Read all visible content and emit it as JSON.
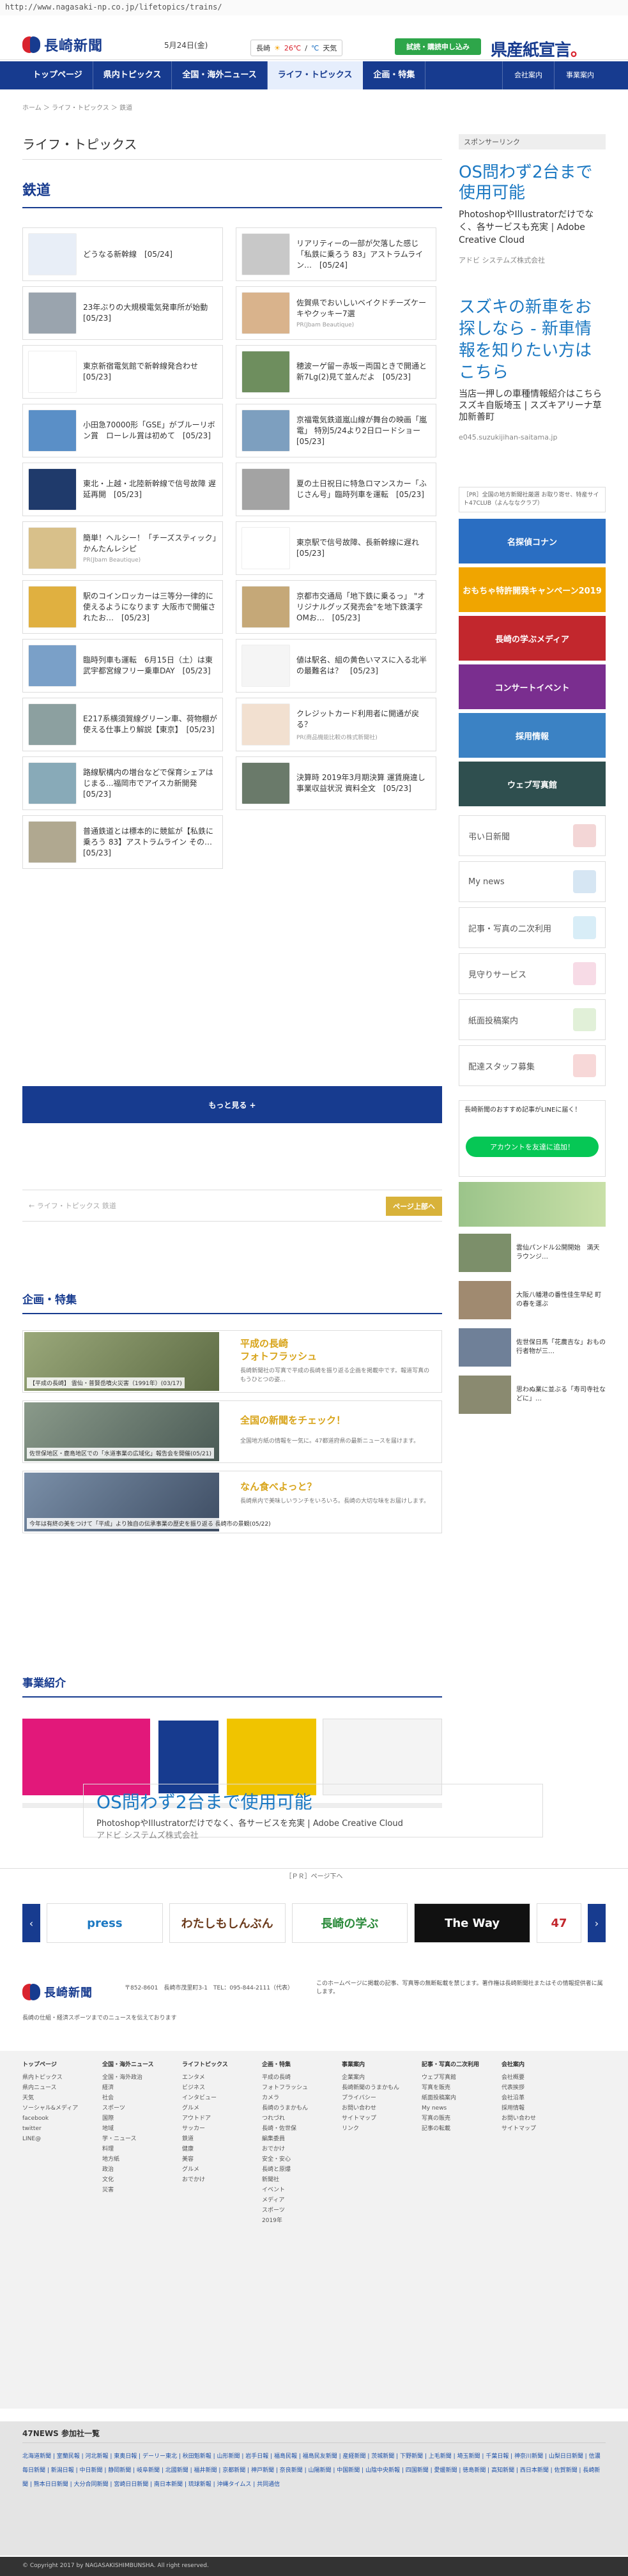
{
  "url": "http://www.nagasaki-np.co.jp/lifetopics/trains/",
  "header": {
    "logo_text": "長崎新聞",
    "date": "5月24日(金)",
    "weather": {
      "city": "長崎",
      "icon": "sun-icon",
      "hi": "26℃",
      "sep": "/",
      "lo": "",
      "unit": "℃",
      "label": "天気"
    },
    "trial_label": "試読・購読申し込み",
    "ad_text": "県産紙宣言",
    "ad_dot": "。"
  },
  "nav": {
    "items": [
      "トップページ",
      "県内トピックス",
      "全国・海外ニュース",
      "ライフ・トピックス",
      "企画・特集"
    ],
    "right": [
      "会社案内",
      "事業案内"
    ]
  },
  "breadcrumb": "ホーム ＞ ライフ・トピックス ＞ 鉄道",
  "page_title": "ライフ・トピックス",
  "section_title": "鉄道",
  "cards": [
    {
      "title": "どうなる新幹線　[05/24]",
      "sub": ""
    },
    {
      "title": "リアリティーの一部が欠落した感じ「私鉄に乗ろう 83」アストラムライン…　[05/24]",
      "sub": ""
    },
    {
      "title": "23年ぶりの大規模電気発車所が始動　[05/23]",
      "sub": ""
    },
    {
      "title": "佐賀県でおいしいベイクドチーズケーキやクッキー7選",
      "sub": "PR(Jbam Beautique)"
    },
    {
      "title": "東京新宿電気館で新幹線発合わせ　[05/23]",
      "sub": ""
    },
    {
      "title": "穂波ーゲ留ー赤坂ー両国ときで開通と新7Lg(2)見て並んだよ　[05/23]",
      "sub": ""
    },
    {
      "title": "小田急70000形「GSE」がブルーリボン賞　ローレル賞は初めて　[05/23]",
      "sub": ""
    },
    {
      "title": "京福電気鉄道嵐山線が舞台の映画「嵐電」 特別5/24より2日ロードショー　[05/23]",
      "sub": ""
    },
    {
      "title": "東北・上越・北陸新幹線で信号故障 遅延再開　[05/23]",
      "sub": ""
    },
    {
      "title": "夏の土日祝日に特急ロマンスカー「ふじさん号」臨時列車を運転　[05/23]",
      "sub": ""
    },
    {
      "title": "簡単！ヘルシー！「チーズスティック」かんたんレシピ",
      "sub": "PR(Jbam Beautique)"
    },
    {
      "title": "東京駅で信号故障、長新幹線に遅れ　[05/23]",
      "sub": ""
    },
    {
      "title": "駅のコインロッカーは三等分一律的に使えるようになります 大阪市で開催されたお…　[05/23]",
      "sub": ""
    },
    {
      "title": "京都市交通局「地下鉄に乗るっ」 \"オリジナルグッズ発売会\"を地下鉄漢字OMお…　[05/23]",
      "sub": ""
    },
    {
      "title": "臨時列車も運転　6月15日（土）は東武宇都宮線フリー乗車DAY　[05/23]",
      "sub": ""
    },
    {
      "title": "値は駅名、組の黄色いマスに入る北半の最難名は？　[05/23]",
      "sub": ""
    },
    {
      "title": "E217系横須賀線グリーン車、荷物棚が使える仕事上り解説【東京】　[05/23]",
      "sub": ""
    },
    {
      "title": "クレジットカード利用者に開通が戻る？",
      "sub": "PR(商品機能比較の株式新聞社)"
    },
    {
      "title": "路線駅構内の増台などで保育シェアはじまる...福岡市でアイスカ新開発　[05/23]",
      "sub": ""
    },
    {
      "title": "決算時 2019年3月期決算 運賃廃違し事業収益状況 資料全文　[05/23]",
      "sub": ""
    },
    {
      "title": "普通鉄道とは標本的に競鉱が【私鉄に乗ろう 83】アストラムライン その…　[05/23]",
      "sub": ""
    }
  ],
  "more_label": "もっと見る +",
  "pager": {
    "prev": "← ライフ・トピックス 鉄道",
    "next": "ページ上部へ"
  },
  "features_title": "企画・特集",
  "features": [
    {
      "caption": "【平成の長崎】 雲仙・普賢岳噴火災害（1991年）(03/17)",
      "title_line1": "平成の長崎",
      "title_line2": "フォトフラッシュ",
      "desc": "長崎新聞社の写真で平成の長崎を振り返る企画を掲載中です。報道写真のもうひとつの姿…"
    },
    {
      "caption": "佐世保地区・鹿島地区での「水道事業の広域化」報告会を開催(05/21)",
      "title_line1": "",
      "title_line2": "全国の新聞をチェック！",
      "desc": "全国地方紙の情報を一気に。47都道府県の最新ニュースを届けます。"
    },
    {
      "caption": "今年は有終の美をつけて「平成」より独自の伝承事業の歴史を振り返る 長崎市の景観(05/22)",
      "title_line1": "",
      "title_line2": "なん食べよっと？",
      "desc": "長崎県内で美味しいランチをいろいろ。長崎の大切な味をお届けします。"
    }
  ],
  "biz_title": "事業紹介",
  "side": {
    "sponsor_label": "スポンサーリンク",
    "ad1_title": "OS問わず2台まで使用可能",
    "ad1_sub": "PhotoshopやIllustratorだけでなく、各サービスも充実 | Adobe Creative Cloud",
    "ad1_small": "アドビ システムズ株式会社",
    "ad2_title": "スズキの新車をお探しなら - 新車情報を知りたい方はこちら",
    "ad2_sub": "当店一押しの車種情報紹介はこちら スズキ自販埼玉 | スズキアリーナ草加新善町",
    "ad2_small": "e045.suzukijihan-saitama.jp",
    "note": "［PR］全国の地方新聞社厳選 お取り寄せ、特産サイト47CLUB（よんななクラブ）",
    "banner_labels": [
      "名探偵コナン",
      "おもちゃ特許開発キャンペーン2019",
      "長崎の学ぶメディア",
      "コンサートイベント",
      "採用情報",
      "ウェブ写真館"
    ],
    "list": [
      "弔い日新聞",
      "My news",
      "記事・写真の二次利用",
      "見守りサービス",
      "紙面投稿案内",
      "配達スタッフ募集"
    ],
    "line_text": "長崎新聞のおすすめ記事がLINEに届く！",
    "line_btn": "アカウントを友達に追加！",
    "photos": [
      "雲仙パンドル公開開始　満天ラウンジ…",
      "大阪八幡港の番性佳生早紀 町の春を運ぶ",
      "佐世保日馬「花農吉な」おもの行者物が三…",
      "思わぬ業に並ぶる「寿司寺社などに」…"
    ]
  },
  "gap_ad": {
    "title": "OS問わず2台まで使用可能",
    "sub": "PhotoshopやIllustratorだけでなく、各サービスを充実 | Adobe Creative Cloud",
    "small": "アドビ システムズ株式会社"
  },
  "pr_label": "［ＰＲ］ページ下へ",
  "carousel": [
    "press",
    "わたしもしんぶん",
    "長崎の学ぶ",
    "The Way",
    "47"
  ],
  "footer": {
    "addr": "〒852-8601　長崎市茂里町3-1　TEL：095-844-2111（代表）",
    "notice": "このホームページに掲載の記事、写真等の無断転載を禁じます。著作権は長崎新聞社またはその情報提供者に属します。",
    "desc": "長崎の仕組・経済スポーツまでのニュースを伝えております",
    "cols": [
      {
        "h": "トップページ",
        "items": [
          "県内トピックス",
          "県内ニュース",
          "天気",
          "ソーシャル&メディア",
          "facebook",
          "twitter",
          "LINE@"
        ]
      },
      {
        "h": "全国・海外ニュース",
        "items": [
          "全国・海外政治",
          "経済",
          "社会",
          "スポーツ",
          "国際",
          "地域",
          "学・ニュース",
          "料理",
          "地方紙",
          "政治",
          "文化",
          "災害"
        ]
      },
      {
        "h": "ライフトピックス",
        "items": [
          "エンタメ",
          "ビジネス",
          "インタビュー",
          "グルメ",
          "アウトドア",
          "サッカー",
          "鉄道",
          "健康",
          "美容",
          "グルメ",
          "おでかけ"
        ]
      },
      {
        "h": "企画・特集",
        "items": [
          "平成の長崎",
          "フォトフラッシュ",
          "カメラ",
          "長崎のうまかもん",
          "つれづれ",
          "長崎・佐世保",
          "編集委員",
          "おでかけ",
          "安全・安心",
          "長崎と原爆",
          "新聞社",
          "イベント",
          "メディア",
          "スポーツ",
          "2019年"
        ]
      },
      {
        "h": "事業案内",
        "items": [
          "企業案内",
          "長崎新聞のうまかもん",
          "プライバシー",
          "お問い合わせ",
          "サイトマップ",
          "リンク"
        ]
      },
      {
        "h": "記事・写真の二次利用",
        "items": [
          "ウェブ写真館",
          "写真を販売",
          "紙面投稿案内",
          "My news",
          "写真の販売",
          "記事の転載"
        ]
      },
      {
        "h": "会社案内",
        "items": [
          "会社概要",
          "代表挨拶",
          "会社沿革",
          "採用情報",
          "お問い合わせ",
          "サイトマップ"
        ]
      }
    ]
  },
  "news47": {
    "title": "47NEWS 参加社一覧",
    "links": "北海道新聞 | 室蘭民報 | 河北新報 | 東奥日報 | デーリー東北 | 秋田魁新報 | 山形新聞 | 岩手日報 | 福島民報 | 福島民友新聞 | 産経新聞 | 茨城新聞 | 下野新聞 | 上毛新聞 | 埼玉新聞 | 千葉日報 | 神奈川新聞 | 山梨日日新聞 | 信濃毎日新聞 | 新潟日報 | 中日新聞 | 静岡新聞 | 岐阜新聞 | 北國新聞 | 福井新聞 | 京都新聞 | 神戸新聞 | 奈良新聞 | 山陽新聞 | 中国新聞 | 山陰中央新報 | 四国新聞 | 愛媛新聞 | 徳島新聞 | 高知新聞 | 西日本新聞 | 佐賀新聞 | 長崎新聞 | 熊本日日新聞 | 大分合同新聞 | 宮崎日日新聞 | 南日本新聞 | 琉球新報 | 沖縄タイムス | 共同通信"
  },
  "copyright": "© Copyright 2017 by NAGASAKISHIMBUNSHA. All right reserved.",
  "colors": {
    "brand": "#173b8f",
    "accent": "#d9232e",
    "gold": "#d8b23a",
    "line": "#06c755"
  }
}
